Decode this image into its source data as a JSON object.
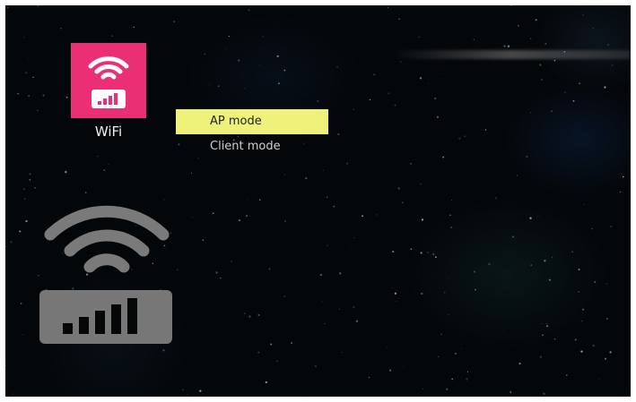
{
  "app": {
    "label": "WiFi",
    "icon": "wifi-router-icon",
    "icon_color": "#ea2f75"
  },
  "menu": {
    "items": [
      {
        "label": "AP mode",
        "selected": true
      },
      {
        "label": "Client mode",
        "selected": false
      }
    ],
    "highlight_color": "#eef27a"
  },
  "preview": {
    "icon": "wifi-router-large-icon",
    "color": "#777777"
  }
}
